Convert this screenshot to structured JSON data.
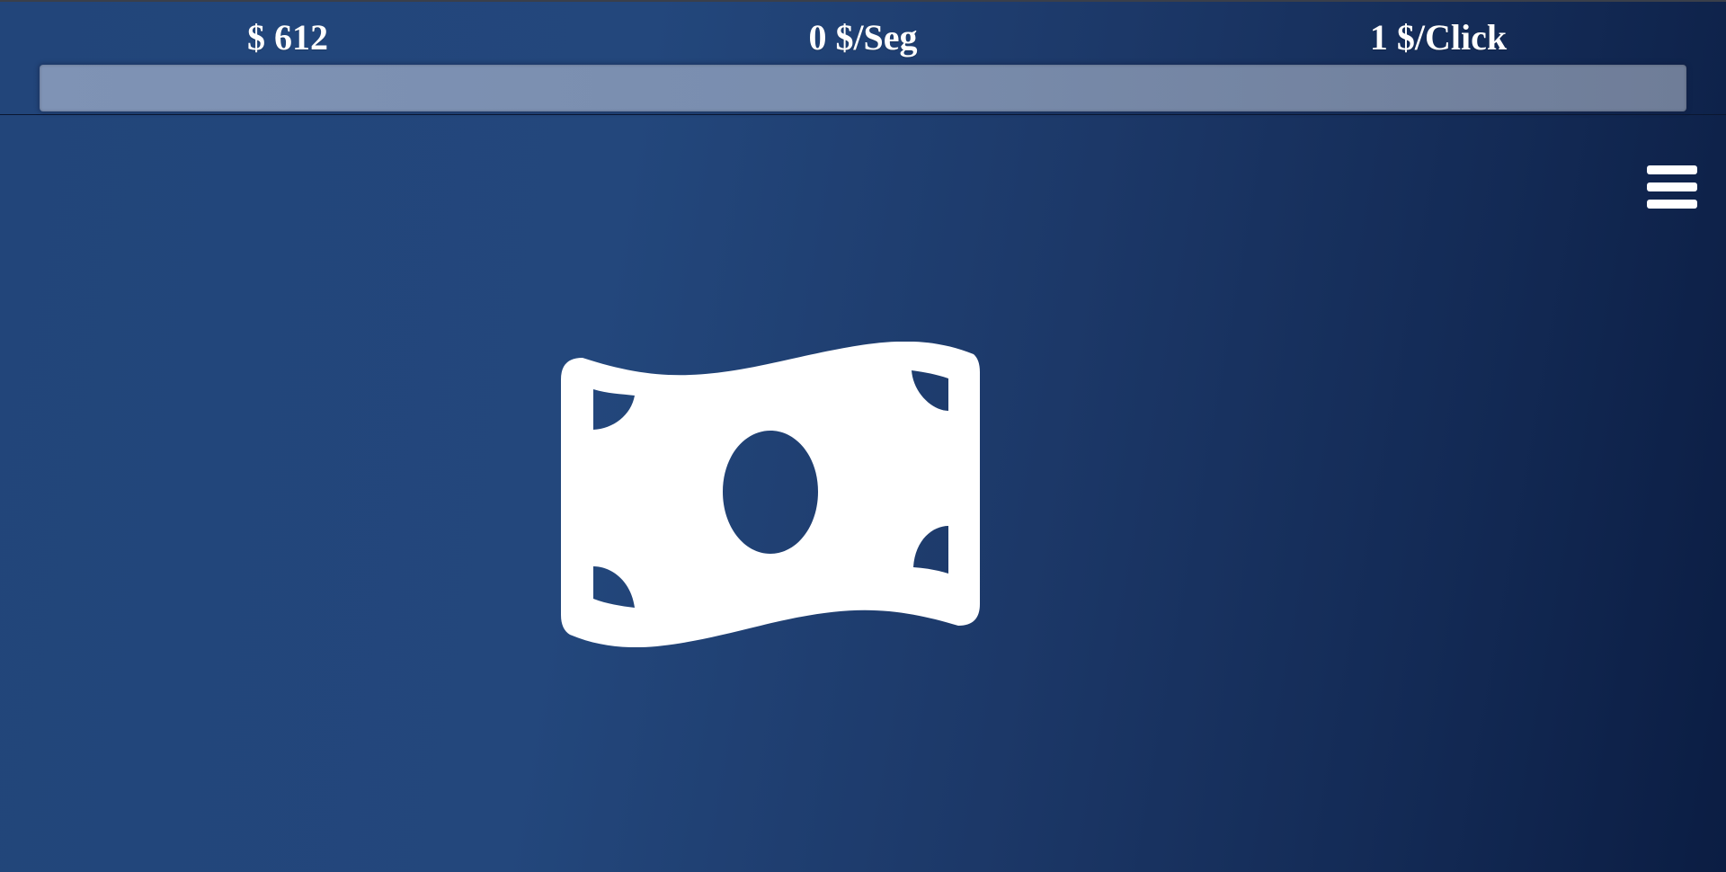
{
  "stats": {
    "money": "$ 612",
    "per_second": "0 $/Seg",
    "per_click": "1 $/Click"
  },
  "progress": {
    "fraction": 0
  },
  "icons": {
    "menu": "hamburger-menu-icon",
    "clicker": "money-bill-wave-icon"
  },
  "colors": {
    "background_start": "#23477c",
    "background_end": "#0b1d43",
    "icon": "#ffffff",
    "progress_track": "#7a8eaf"
  }
}
